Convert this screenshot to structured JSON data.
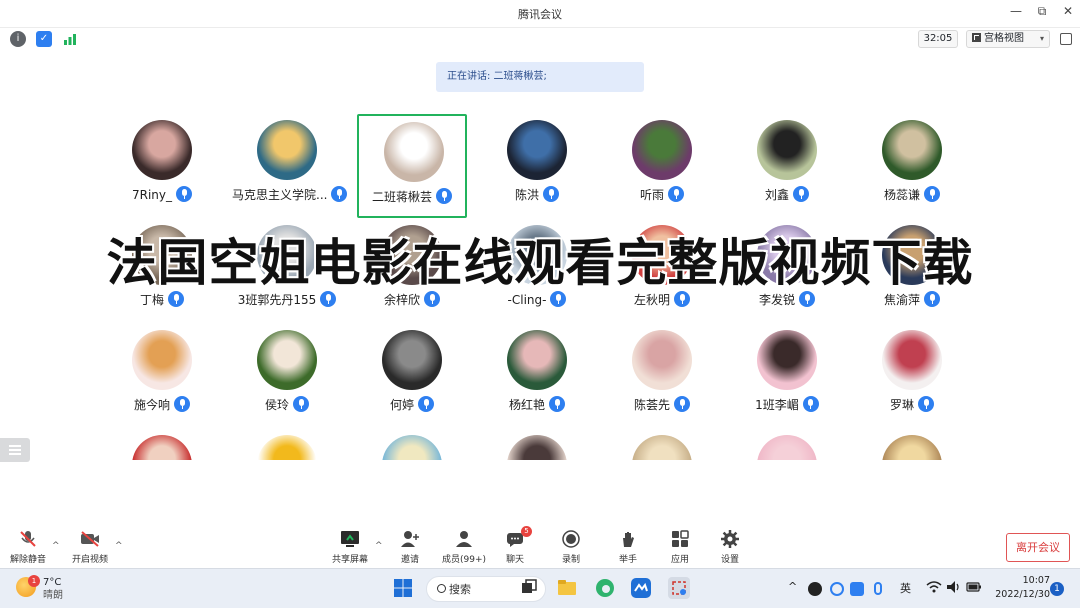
{
  "window": {
    "title": "腾讯会议",
    "controls": [
      "—",
      "⧉",
      "✕"
    ]
  },
  "toolbar": {
    "timer": "32:05",
    "view_label": "宫格视图",
    "view_arrow": "▾"
  },
  "speaking_banner": "正在讲话: 二班蒋楸芸;",
  "participants": [
    {
      "name": "7Riny_",
      "colors": [
        "#3a2a2a",
        "#d8a7a0"
      ],
      "active": false
    },
    {
      "name": "马克思主义学院...",
      "colors": [
        "#2e6a86",
        "#f1c76b"
      ],
      "active": false
    },
    {
      "name": "二班蒋楸芸",
      "colors": [
        "#c9b6a8",
        "#ffffff"
      ],
      "active": true
    },
    {
      "name": "陈洪",
      "colors": [
        "#1c2434",
        "#3f6fa8"
      ],
      "active": false
    },
    {
      "name": "听雨",
      "colors": [
        "#6d3b6a",
        "#4a7a3a"
      ],
      "active": false
    },
    {
      "name": "刘鑫",
      "colors": [
        "#b7c49a",
        "#222222"
      ],
      "active": false
    },
    {
      "name": "杨蕊谦",
      "colors": [
        "#2f5a2a",
        "#d0c0a0"
      ],
      "active": false
    },
    {
      "name": "丁梅",
      "colors": [
        "#7a6a5a",
        "#c8b8a8"
      ],
      "active": false
    },
    {
      "name": "3班郭先丹155",
      "colors": [
        "#9aa7b4",
        "#e0e0e0"
      ],
      "active": false
    },
    {
      "name": "余梓欣",
      "colors": [
        "#5a4a4a",
        "#b0a090"
      ],
      "active": false
    },
    {
      "name": "-Cling-",
      "colors": [
        "#c8d4e0",
        "#6a7a8a"
      ],
      "active": false
    },
    {
      "name": "左秋明",
      "colors": [
        "#d04040",
        "#f0c0a0"
      ],
      "active": false
    },
    {
      "name": "李发锐",
      "colors": [
        "#8a7aa8",
        "#d8c8e8"
      ],
      "active": false
    },
    {
      "name": "焦渝萍",
      "colors": [
        "#2a3a5a",
        "#c8a070"
      ],
      "active": false
    },
    {
      "name": "施今响",
      "colors": [
        "#f7e7e4",
        "#e3a054"
      ],
      "active": false
    },
    {
      "name": "侯玲",
      "colors": [
        "#3d6b2a",
        "#f2e6d8"
      ],
      "active": false
    },
    {
      "name": "何婷",
      "colors": [
        "#2a2a2a",
        "#8a8a8a"
      ],
      "active": false
    },
    {
      "name": "杨红艳",
      "colors": [
        "#2a5a3a",
        "#e6b8b8"
      ],
      "active": false
    },
    {
      "name": "陈荟先",
      "colors": [
        "#f1dfd6",
        "#d9a4a4"
      ],
      "active": false
    },
    {
      "name": "1班李嵋",
      "colors": [
        "#f2c2d0",
        "#3a2a2a"
      ],
      "active": false
    },
    {
      "name": "罗琳",
      "colors": [
        "#f4f0f0",
        "#c04050"
      ],
      "active": false
    },
    {
      "name": "",
      "colors": [
        "#c83030",
        "#f0d0c0"
      ],
      "active": false
    },
    {
      "name": "",
      "colors": [
        "#ffffff",
        "#f2b91c"
      ],
      "active": false
    },
    {
      "name": "",
      "colors": [
        "#7ab8d8",
        "#f0e8c0"
      ],
      "active": false
    },
    {
      "name": "",
      "colors": [
        "#e0d0c8",
        "#4a3a3a"
      ],
      "active": false
    },
    {
      "name": "",
      "colors": [
        "#c8b08a",
        "#f0e0c0"
      ],
      "active": false
    },
    {
      "name": "",
      "colors": [
        "#f0b8c8",
        "#f5d0d8"
      ],
      "active": false
    },
    {
      "name": "",
      "colors": [
        "#b08a5a",
        "#f0d8a0"
      ],
      "active": false
    }
  ],
  "overlay_text": "法国空姐电影在线观看完整版视频下载",
  "controls": {
    "unmute": "解除静音",
    "start_video": "开启视频",
    "share_screen": "共享屏幕",
    "invite": "邀请",
    "members": "成员(99+)",
    "chat": "聊天",
    "chat_badge": "5",
    "record": "录制",
    "raise_hand": "举手",
    "apps": "应用",
    "settings": "设置",
    "leave": "离开会议",
    "caret": "^"
  },
  "taskbar": {
    "weather_temp": "7°C",
    "weather_desc": "晴朗",
    "weather_badge": "1",
    "search_label": "搜索",
    "ime": "英",
    "time": "10:07",
    "date": "2022/12/30",
    "notification_count": "1",
    "tray_caret": "^"
  },
  "colors": {
    "accent": "#2e7ff0",
    "active_border": "#21b35c",
    "leave_red": "#d93b3b",
    "banner_bg": "#e2ebfb"
  }
}
